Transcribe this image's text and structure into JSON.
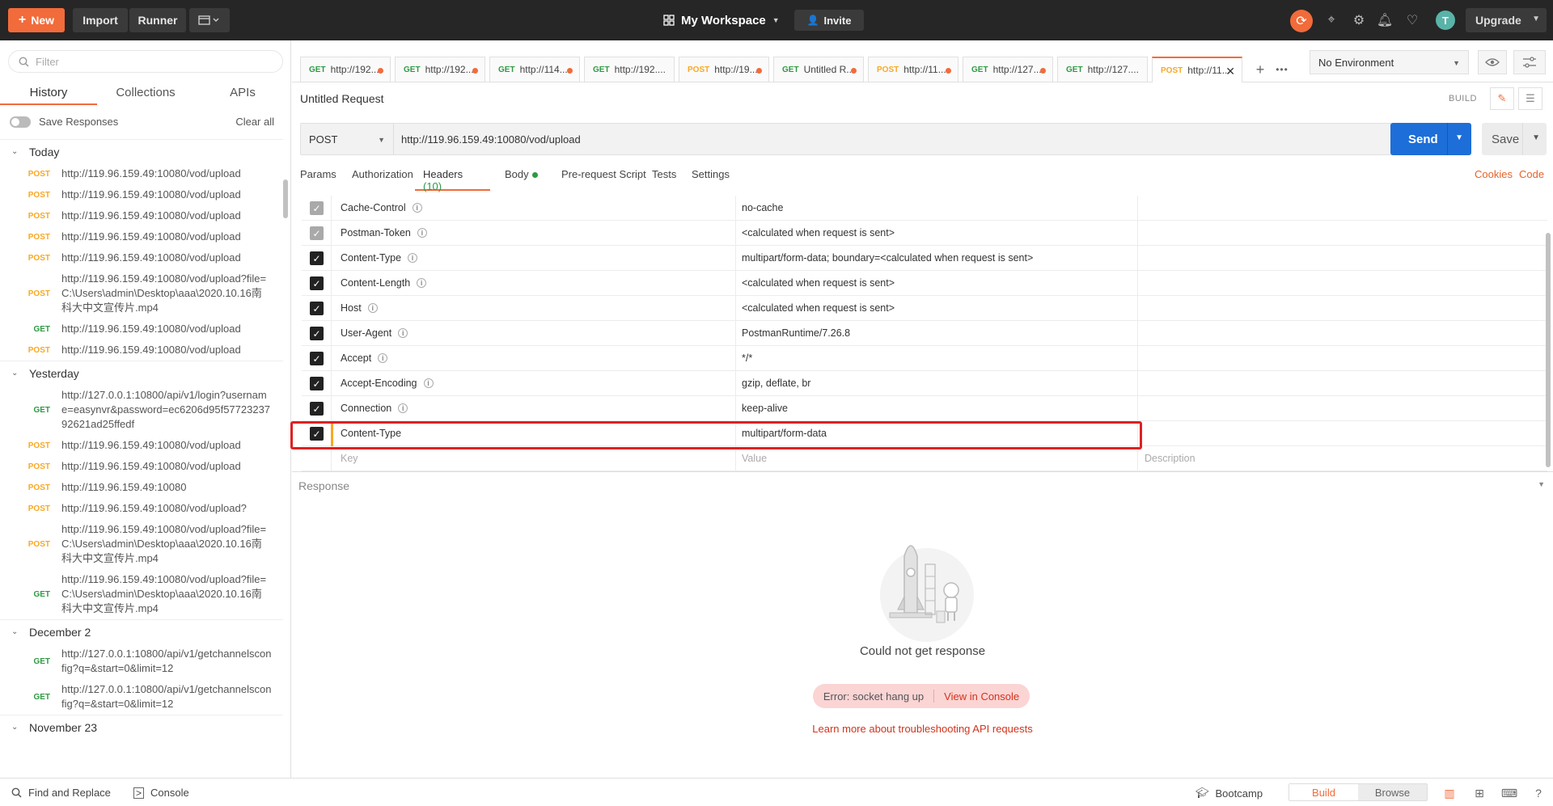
{
  "topbar": {
    "new_label": "New",
    "import_label": "Import",
    "runner_label": "Runner",
    "workspace_label": "My Workspace",
    "invite_label": "Invite",
    "upgrade_label": "Upgrade",
    "avatar_letter": "T",
    "accent_color": "#f26b3a"
  },
  "sidebar": {
    "filter_placeholder": "Filter",
    "tabs": [
      "History",
      "Collections",
      "APIs"
    ],
    "save_responses_label": "Save Responses",
    "clear_all_label": "Clear all",
    "groups": [
      {
        "label": "Today",
        "items": [
          {
            "method": "POST",
            "url": "http://119.96.159.49:10080/vod/upload"
          },
          {
            "method": "POST",
            "url": "http://119.96.159.49:10080/vod/upload"
          },
          {
            "method": "POST",
            "url": "http://119.96.159.49:10080/vod/upload"
          },
          {
            "method": "POST",
            "url": "http://119.96.159.49:10080/vod/upload"
          },
          {
            "method": "POST",
            "url": "http://119.96.159.49:10080/vod/upload"
          },
          {
            "method": "POST",
            "url": "http://119.96.159.49:10080/vod/upload?file=C:\\Users\\admin\\Desktop\\aaa\\2020.10.16南科大中文宣传片.mp4"
          },
          {
            "method": "GET",
            "url": "http://119.96.159.49:10080/vod/upload"
          },
          {
            "method": "POST",
            "url": "http://119.96.159.49:10080/vod/upload"
          }
        ]
      },
      {
        "label": "Yesterday",
        "items": [
          {
            "method": "GET",
            "url": "http://127.0.0.1:10800/api/v1/login?username=easynvr&password=ec6206d95f5772323792621ad25ffedf"
          },
          {
            "method": "POST",
            "url": "http://119.96.159.49:10080/vod/upload"
          },
          {
            "method": "POST",
            "url": "http://119.96.159.49:10080/vod/upload"
          },
          {
            "method": "POST",
            "url": "http://119.96.159.49:10080"
          },
          {
            "method": "POST",
            "url": "http://119.96.159.49:10080/vod/upload?"
          },
          {
            "method": "POST",
            "url": "http://119.96.159.49:10080/vod/upload?file=C:\\Users\\admin\\Desktop\\aaa\\2020.10.16南科大中文宣传片.mp4"
          },
          {
            "method": "GET",
            "url": "http://119.96.159.49:10080/vod/upload?file=C:\\Users\\admin\\Desktop\\aaa\\2020.10.16南科大中文宣传片.mp4"
          }
        ]
      },
      {
        "label": "December 2",
        "items": [
          {
            "method": "GET",
            "url": "http://127.0.0.1:10800/api/v1/getchannelsconfig?q=&start=0&limit=12"
          },
          {
            "method": "GET",
            "url": "http://127.0.0.1:10800/api/v1/getchannelsconfig?q=&start=0&limit=12"
          }
        ]
      },
      {
        "label": "November 23",
        "items": []
      }
    ]
  },
  "request_tabs": [
    {
      "method": "GET",
      "label": "http://192....",
      "dot": true
    },
    {
      "method": "GET",
      "label": "http://192....",
      "dot": true
    },
    {
      "method": "GET",
      "label": "http://114....",
      "dot": true
    },
    {
      "method": "GET",
      "label": "http://192....",
      "dot": false
    },
    {
      "method": "POST",
      "label": "http://19...",
      "dot": true
    },
    {
      "method": "GET",
      "label": "Untitled R...",
      "dot": true
    },
    {
      "method": "POST",
      "label": "http://11...",
      "dot": true
    },
    {
      "method": "GET",
      "label": "http://127....",
      "dot": true
    },
    {
      "method": "GET",
      "label": "http://127....",
      "dot": false
    },
    {
      "method": "POST",
      "label": "http://11...",
      "dot": false,
      "active": true
    }
  ],
  "environment": {
    "selected": "No Environment"
  },
  "request": {
    "title": "Untitled Request",
    "build_label": "BUILD",
    "method": "POST",
    "url": "http://119.96.159.49:10080/vod/upload",
    "send_label": "Send",
    "save_label": "Save",
    "tabs": {
      "params": "Params",
      "authorization": "Authorization",
      "headers": "Headers",
      "headers_count": "(10)",
      "body": "Body",
      "prerequest": "Pre-request Script",
      "tests": "Tests",
      "settings": "Settings"
    },
    "cookies_label": "Cookies",
    "code_label": "Code"
  },
  "headers": [
    {
      "key": "Cache-Control",
      "value": "no-cache",
      "checked": "light",
      "info": true
    },
    {
      "key": "Postman-Token",
      "value": "<calculated when request is sent>",
      "checked": "light",
      "info": true
    },
    {
      "key": "Content-Type",
      "value": "multipart/form-data; boundary=<calculated when request is sent>",
      "checked": "dark",
      "info": true
    },
    {
      "key": "Content-Length",
      "value": "<calculated when request is sent>",
      "checked": "dark",
      "info": true
    },
    {
      "key": "Host",
      "value": "<calculated when request is sent>",
      "checked": "dark",
      "info": true
    },
    {
      "key": "User-Agent",
      "value": "PostmanRuntime/7.26.8",
      "checked": "dark",
      "info": true
    },
    {
      "key": "Accept",
      "value": "*/*",
      "checked": "dark",
      "info": true
    },
    {
      "key": "Accept-Encoding",
      "value": "gzip, deflate, br",
      "checked": "dark",
      "info": true
    },
    {
      "key": "Connection",
      "value": "keep-alive",
      "checked": "dark",
      "info": true
    },
    {
      "key": "Content-Type",
      "value": "multipart/form-data",
      "checked": "dark",
      "info": false
    }
  ],
  "headers_placeholder": {
    "key": "Key",
    "value": "Value",
    "description": "Description"
  },
  "response": {
    "label": "Response",
    "empty_title": "Could not get response",
    "error_text": "Error: socket hang up",
    "view_console": "View in Console",
    "learn_more": "Learn more about troubleshooting API requests"
  },
  "statusbar": {
    "find_replace": "Find and Replace",
    "console": "Console",
    "bootcamp": "Bootcamp",
    "build": "Build",
    "browse": "Browse"
  }
}
